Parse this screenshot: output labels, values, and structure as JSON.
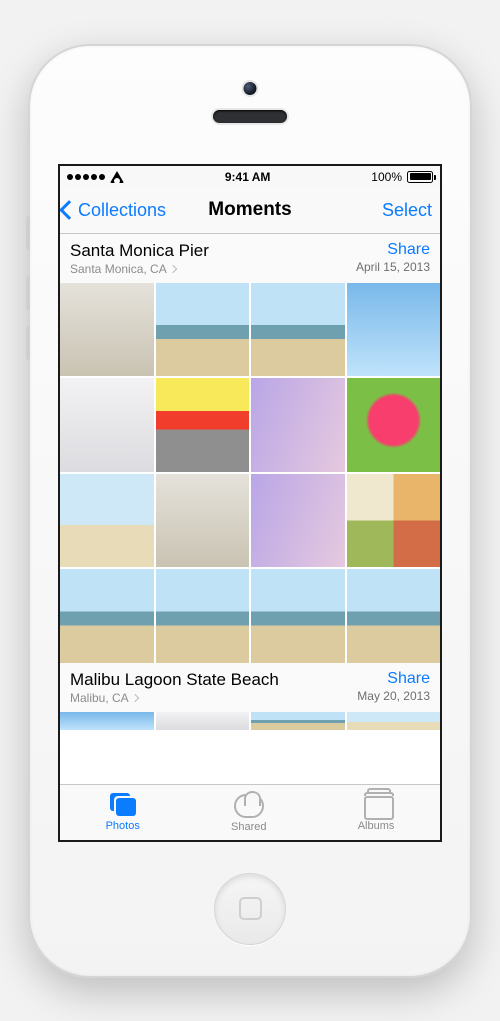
{
  "status_bar": {
    "time": "9:41 AM",
    "battery_pct": "100%"
  },
  "nav": {
    "back_label": "Collections",
    "title": "Moments",
    "right_label": "Select"
  },
  "sections": [
    {
      "title": "Santa Monica Pier",
      "subtitle": "Santa Monica, CA",
      "share_label": "Share",
      "date": "April 15, 2013"
    },
    {
      "title": "Malibu Lagoon State Beach",
      "subtitle": "Malibu, CA",
      "share_label": "Share",
      "date": "May 20, 2013"
    }
  ],
  "tabs": {
    "photos": "Photos",
    "shared": "Shared",
    "albums": "Albums"
  },
  "colors": {
    "accent": "#0b7bff"
  }
}
